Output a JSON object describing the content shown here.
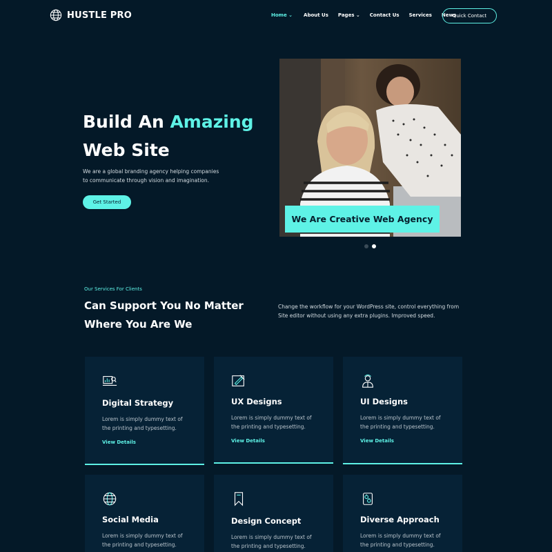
{
  "brand": {
    "name": "HUSTLE PRO"
  },
  "nav": {
    "items": [
      {
        "label": "Home",
        "has_dropdown": true,
        "active": true
      },
      {
        "label": "About Us",
        "has_dropdown": false,
        "active": false
      },
      {
        "label": "Pages",
        "has_dropdown": true,
        "active": false
      },
      {
        "label": "Contact Us",
        "has_dropdown": false,
        "active": false
      },
      {
        "label": "Services",
        "has_dropdown": false,
        "active": false
      },
      {
        "label": "News",
        "has_dropdown": false,
        "active": false
      }
    ],
    "cta_label": "Quick Contact"
  },
  "hero": {
    "title_part1": "Build An ",
    "title_accent": "Amazing",
    "title_part2": "Web Site",
    "description": "We are a global branding agency helping companies to communicate through vision and imagination.",
    "button_label": "Get Started",
    "badge": "We Are Creative Web Agency",
    "slider": {
      "total": 2,
      "active": 2
    }
  },
  "services": {
    "eyebrow": "Our Services For Clients",
    "title": "Can Support You No Matter Where You Are We",
    "description": "Change the workflow for your WordPress site, control everything from Site editor without using any extra plugins. Improved speed.",
    "cards": [
      {
        "icon": "strategy-chart-icon",
        "title": "Digital Strategy",
        "desc": "Lorem is simply dummy text of the printing and typesetting.",
        "link": "View Details"
      },
      {
        "icon": "design-pen-icon",
        "title": "UX Designs",
        "desc": "Lorem is simply dummy text of the printing and typesetting.",
        "link": "View Details"
      },
      {
        "icon": "designer-person-icon",
        "title": "UI Designs",
        "desc": "Lorem is simply dummy text of the printing and typesetting.",
        "link": "View Details"
      },
      {
        "icon": "globe-icon",
        "title": "Social Media",
        "desc": "Lorem is simply dummy text of the printing and typesetting.",
        "link": ""
      },
      {
        "icon": "bookmark-icon",
        "title": "Design Concept",
        "desc": "Lorem is simply dummy text of the printing and typesetting.",
        "link": ""
      },
      {
        "icon": "gears-icon",
        "title": "Diverse Approach",
        "desc": "Lorem is simply dummy text of the printing and typesetting.",
        "link": ""
      }
    ]
  },
  "colors": {
    "background": "#041928",
    "card": "#062236",
    "accent": "#5ef2e6"
  }
}
